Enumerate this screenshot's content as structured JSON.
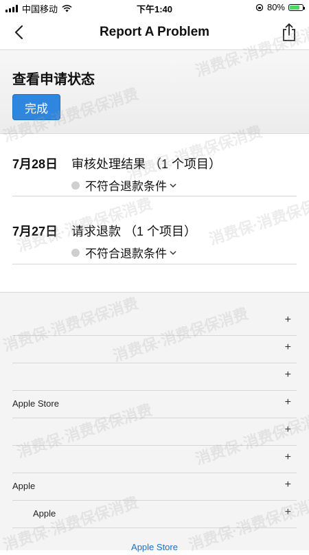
{
  "status_bar": {
    "carrier": "中国移动",
    "time": "下午1:40",
    "battery": "80%",
    "battery_level": 0.8
  },
  "nav": {
    "title": "Report A Problem",
    "back_icon": "chevron-left-icon",
    "share_icon": "share-icon"
  },
  "status_panel": {
    "heading": "查看申请状态",
    "done_label": "完成",
    "done_color": "#2f86de"
  },
  "requests": [
    {
      "date": "7月28日",
      "title": "审核处理结果 （1 个项目）",
      "status": "不符合退款条件"
    },
    {
      "date": "7月27日",
      "title": "请求退款 （1 个项目）",
      "status": "不符合退款条件"
    }
  ],
  "footer": {
    "rows": [
      {
        "label": "",
        "plus": "+"
      },
      {
        "label": "",
        "plus": "+"
      },
      {
        "label": "",
        "plus": "+"
      },
      {
        "label": "Apple Store",
        "plus": "+"
      },
      {
        "label": "",
        "plus": "+"
      },
      {
        "label": "",
        "plus": "+"
      },
      {
        "label": "Apple",
        "plus": "+"
      },
      {
        "label": "Apple",
        "plus": "+"
      }
    ],
    "link": "Apple Store"
  },
  "watermark_text": "消费保·消费保保消费"
}
